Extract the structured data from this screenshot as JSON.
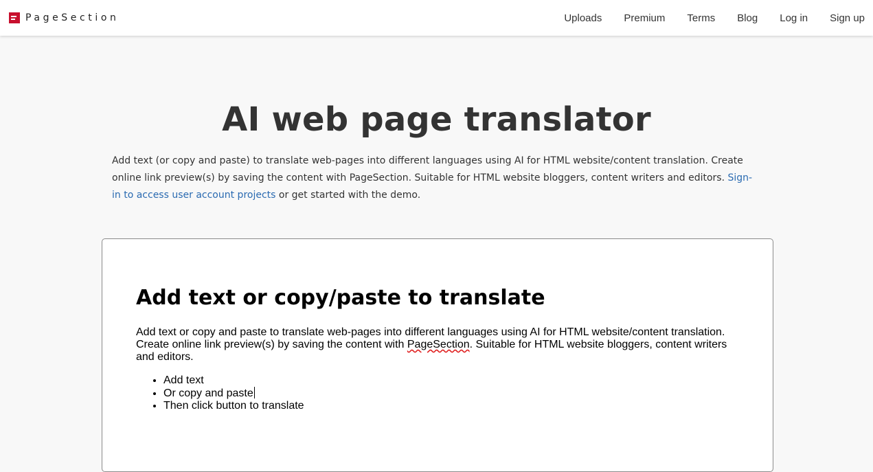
{
  "header": {
    "brand": "PageSection",
    "nav": [
      "Uploads",
      "Premium",
      "Terms",
      "Blog",
      "Log in",
      "Sign up"
    ]
  },
  "hero": {
    "title": "AI web page translator",
    "description": "Add text (or copy and paste) to translate web-pages into different languages using AI for HTML website/content translation. Create online link preview(s) by saving the content with PageSection. Suitable for HTML website bloggers, content writers and editors.",
    "link_text": "Sign-in to access user account projects",
    "suffix": "or get started with the demo."
  },
  "editor": {
    "heading": "Add text or copy/paste to translate",
    "paragraph_before": "Add text or copy and paste to translate web-pages into different languages using AI for HTML website/content translation. Create online link preview(s) by saving the content with",
    "paragraph_brand": "PageSection",
    "paragraph_after": ". Suitable for HTML website bloggers, content writers and editors.",
    "list": [
      "Add text",
      "Or copy and paste",
      "Then click button to translate"
    ]
  },
  "colors": {
    "brand_red": "#c8102e",
    "link_blue": "#2a6ab1",
    "background": "#f8f8f8"
  },
  "icons": {
    "brand": "pagesection-logo-icon"
  }
}
